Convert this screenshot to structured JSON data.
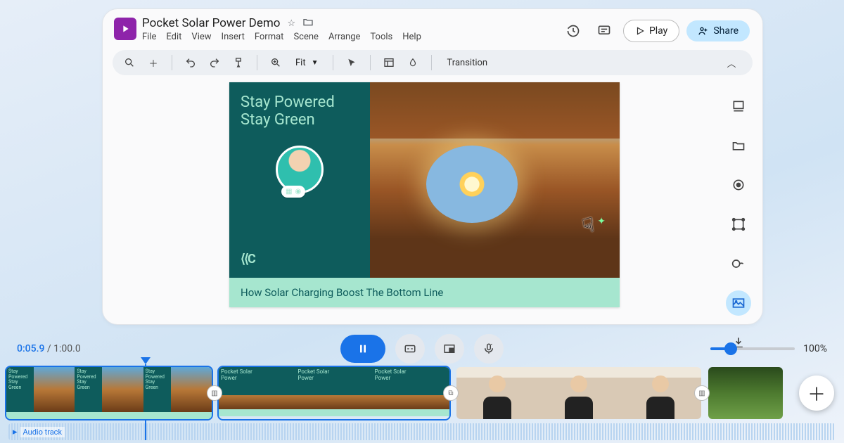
{
  "header": {
    "title": "Pocket Solar Power Demo",
    "menus": [
      "File",
      "Edit",
      "View",
      "Insert",
      "Format",
      "Scene",
      "Arrange",
      "Tools",
      "Help"
    ],
    "play_label": "Play",
    "share_label": "Share"
  },
  "toolbar": {
    "fit_label": "Fit",
    "transition_label": "Transition"
  },
  "slide": {
    "headline": "Stay Powered\nStay Green",
    "caption": "How Solar Charging Boost The Bottom Line",
    "logo": "⟨⟨C"
  },
  "timeline": {
    "current": "0:05.9",
    "total": "1:00.0",
    "zoom_pct": "100%",
    "thumbs": {
      "t1_title": "Stay Powered\nStay Green",
      "t2_title": "Pocket Solar\nPower"
    },
    "audio_label": "Audio track"
  }
}
